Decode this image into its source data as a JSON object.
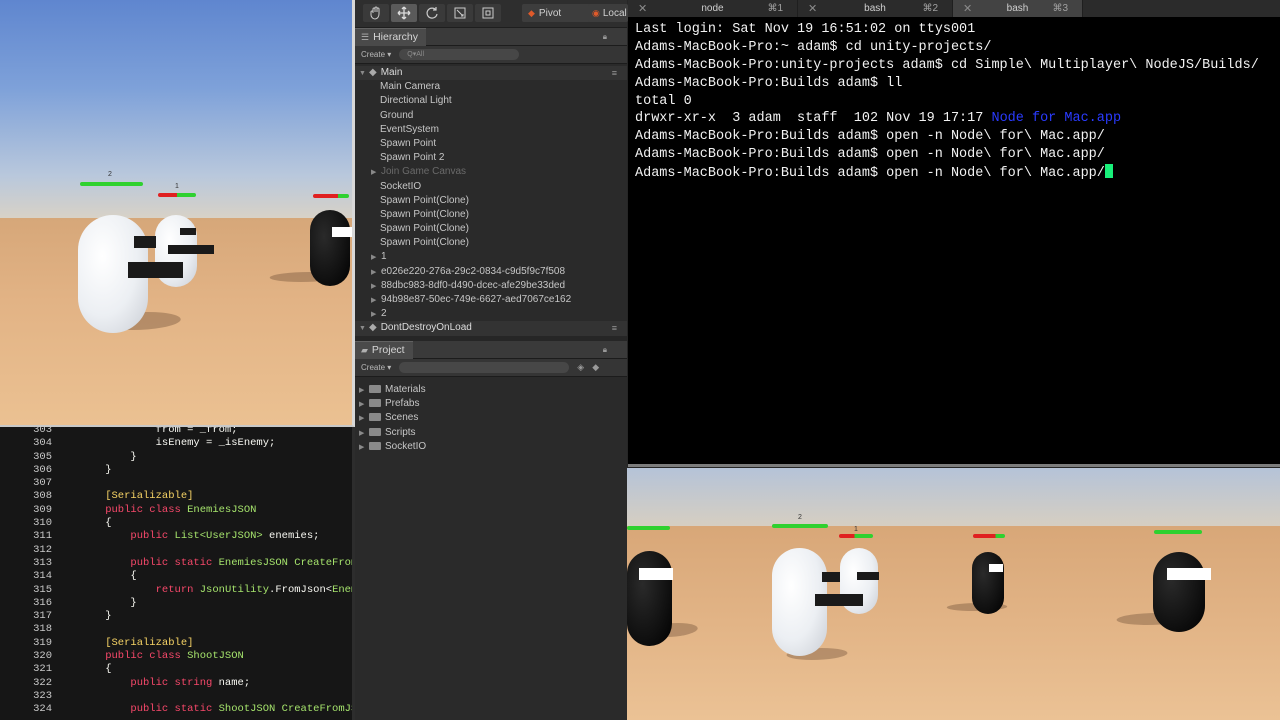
{
  "unity_toolbar": {
    "pivot": "Pivot",
    "local": "Local"
  },
  "hierarchy": {
    "tab_label": "Hierarchy",
    "create_label": "Create",
    "search_placeholder": "Q▾All",
    "scene_name": "Main",
    "items": [
      {
        "label": "Main Camera",
        "muted": false,
        "child": true
      },
      {
        "label": "Directional Light",
        "muted": false,
        "child": true
      },
      {
        "label": "Ground",
        "muted": false,
        "child": true
      },
      {
        "label": "EventSystem",
        "muted": false,
        "child": true
      },
      {
        "label": "Spawn Point",
        "muted": false,
        "child": true
      },
      {
        "label": "Spawn Point 2",
        "muted": false,
        "child": true
      },
      {
        "label": "Join Game Canvas",
        "muted": true,
        "child": true
      },
      {
        "label": "SocketIO",
        "muted": false,
        "child": true
      },
      {
        "label": "Spawn Point(Clone)",
        "muted": false,
        "child": true
      },
      {
        "label": "Spawn Point(Clone)",
        "muted": false,
        "child": true
      },
      {
        "label": "Spawn Point(Clone)",
        "muted": false,
        "child": true
      },
      {
        "label": "Spawn Point(Clone)",
        "muted": false,
        "child": true
      },
      {
        "label": "1",
        "muted": false,
        "child": false
      },
      {
        "label": "e026e220-276a-29c2-0834-c9d5f9c7f508",
        "muted": false,
        "child": false
      },
      {
        "label": "88dbc983-8df0-d490-dcec-afe29be33ded",
        "muted": false,
        "child": false
      },
      {
        "label": "94b98e87-50ec-749e-6627-aed7067ce162",
        "muted": false,
        "child": false
      },
      {
        "label": "2",
        "muted": false,
        "child": false
      }
    ],
    "dont_destroy": "DontDestroyOnLoad"
  },
  "project": {
    "tab_label": "Project",
    "create_label": "Create",
    "folders": [
      "Materials",
      "Prefabs",
      "Scenes",
      "Scripts",
      "SocketIO"
    ]
  },
  "terminal": {
    "tabs": [
      {
        "name": "node",
        "shortcut": "⌘1",
        "active": false
      },
      {
        "name": "bash",
        "shortcut": "⌘2",
        "active": false
      },
      {
        "name": "bash",
        "shortcut": "⌘3",
        "active": true
      }
    ],
    "lines": [
      "Last login: Sat Nov 19 16:51:02 on ttys001",
      "Adams-MacBook-Pro:~ adam$ cd unity-projects/",
      "Adams-MacBook-Pro:unity-projects adam$ cd Simple\\ Multiplayer\\ NodeJS/Builds/",
      "Adams-MacBook-Pro:Builds adam$ ll",
      "total 0",
      "drwxr-xr-x  3 adam  staff  102 Nov 19 17:17 ",
      "Adams-MacBook-Pro:Builds adam$ open -n Node\\ for\\ Mac.app/",
      "Adams-MacBook-Pro:Builds adam$ open -n Node\\ for\\ Mac.app/",
      "Adams-MacBook-Pro:Builds adam$ open -n Node\\ for\\ Mac.app/"
    ],
    "ll_entry_name": "Node for Mac.app",
    "ll_entry_color": "#2a3bff",
    "cursor_color": "#18f07a"
  },
  "code": {
    "lines": [
      {
        "n": "303",
        "tokens": [
          {
            "t": "            from = _from;",
            "c": "tx"
          }
        ]
      },
      {
        "n": "304",
        "tokens": [
          {
            "t": "            isEnemy = _isEnemy;",
            "c": "tx"
          }
        ]
      },
      {
        "n": "305",
        "tokens": [
          {
            "t": "        }",
            "c": "tx"
          }
        ]
      },
      {
        "n": "306",
        "tokens": [
          {
            "t": "    }",
            "c": "tx"
          }
        ]
      },
      {
        "n": "307",
        "tokens": []
      },
      {
        "n": "308",
        "tokens": [
          {
            "t": "    [Serializable]",
            "c": "at"
          }
        ]
      },
      {
        "n": "309",
        "tokens": [
          {
            "t": "    public class ",
            "c": "kw"
          },
          {
            "t": "EnemiesJSON",
            "c": "ty"
          }
        ]
      },
      {
        "n": "310",
        "tokens": [
          {
            "t": "    {",
            "c": "tx"
          }
        ]
      },
      {
        "n": "311",
        "tokens": [
          {
            "t": "        public ",
            "c": "kw"
          },
          {
            "t": "List<UserJSON>",
            "c": "ty"
          },
          {
            "t": " enemies;",
            "c": "tx"
          }
        ]
      },
      {
        "n": "312",
        "tokens": []
      },
      {
        "n": "313",
        "tokens": [
          {
            "t": "        public static ",
            "c": "kw"
          },
          {
            "t": "EnemiesJSON ",
            "c": "ty"
          },
          {
            "t": "CreateFromJSON",
            "c": "fn"
          }
        ]
      },
      {
        "n": "314",
        "tokens": [
          {
            "t": "        {",
            "c": "tx"
          }
        ]
      },
      {
        "n": "315",
        "tokens": [
          {
            "t": "            return ",
            "c": "kw"
          },
          {
            "t": "JsonUtility",
            "c": "ty"
          },
          {
            "t": ".FromJson<",
            "c": "tx"
          },
          {
            "t": "EnemiesJSON",
            "c": "ty"
          }
        ]
      },
      {
        "n": "316",
        "tokens": [
          {
            "t": "        }",
            "c": "tx"
          }
        ]
      },
      {
        "n": "317",
        "tokens": [
          {
            "t": "    }",
            "c": "tx"
          }
        ]
      },
      {
        "n": "318",
        "tokens": []
      },
      {
        "n": "319",
        "tokens": [
          {
            "t": "    [Serializable]",
            "c": "at"
          }
        ]
      },
      {
        "n": "320",
        "tokens": [
          {
            "t": "    public class ",
            "c": "kw"
          },
          {
            "t": "ShootJSON",
            "c": "ty"
          }
        ]
      },
      {
        "n": "321",
        "tokens": [
          {
            "t": "    {",
            "c": "tx"
          }
        ]
      },
      {
        "n": "322",
        "tokens": [
          {
            "t": "        public string ",
            "c": "kw"
          },
          {
            "t": "name;",
            "c": "tx"
          }
        ]
      },
      {
        "n": "323",
        "tokens": []
      },
      {
        "n": "324",
        "tokens": [
          {
            "t": "        public static ",
            "c": "kw"
          },
          {
            "t": "ShootJSON ",
            "c": "ty"
          },
          {
            "t": "CreateFromJSON(",
            "c": "fn"
          }
        ]
      }
    ]
  },
  "game_view_top": {
    "label_a": "2",
    "label_b": "1"
  },
  "game_view_bottom": {
    "label_a": "2",
    "label_b": "1"
  }
}
